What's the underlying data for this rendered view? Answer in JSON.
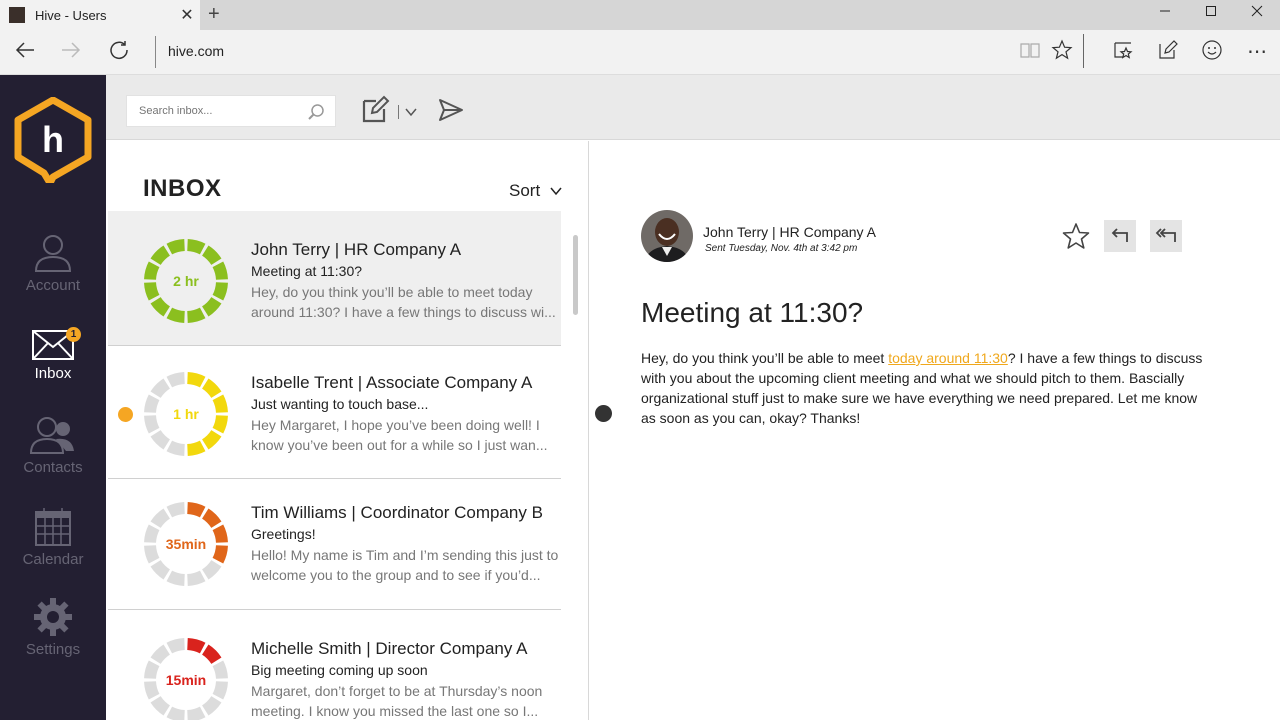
{
  "browser": {
    "tab_title": "Hive - Users",
    "tab_close": "✕",
    "new_tab": "+",
    "address": "hive.com",
    "window_controls": {
      "minimize": "—",
      "maximize": "☐",
      "close": "✕"
    },
    "nav_icons": {
      "back": "←",
      "forward": "→",
      "refresh": "↻",
      "more": "⋯"
    }
  },
  "sidebar": {
    "logo_letter": "h",
    "brand_color": "#f5a623",
    "items": [
      {
        "label": "Account",
        "icon": "person-icon",
        "active": false
      },
      {
        "label": "Inbox",
        "icon": "envelope-icon",
        "active": true,
        "badge": "1"
      },
      {
        "label": "Contacts",
        "icon": "contacts-icon",
        "active": false
      },
      {
        "label": "Calendar",
        "icon": "calendar-icon",
        "active": false
      },
      {
        "label": "Settings",
        "icon": "gear-icon",
        "active": false
      }
    ]
  },
  "toolbar": {
    "search_placeholder": "Search inbox..."
  },
  "inbox": {
    "title": "INBOX",
    "sort_label": "Sort",
    "messages": [
      {
        "from": "John Terry | HR Company A",
        "subject": "Meeting at 11:30?",
        "preview": "Hey, do you think you’ll be able to meet today around 11:30? I have a few things to discuss wi...",
        "timer": "2 hr",
        "color": "#8bbf1f",
        "filled_fraction": 1.0,
        "unread": false,
        "selected": true
      },
      {
        "from": "Isabelle Trent | Associate Company A",
        "subject": "Just wanting to touch base...",
        "preview": "Hey Margaret, I hope you’ve been doing well! I know you’ve been out for a while so I just wan...",
        "timer": "1 hr",
        "color": "#f2d80d",
        "filled_fraction": 0.5,
        "unread": true,
        "selected": false
      },
      {
        "from": "Tim Williams | Coordinator Company B",
        "subject": "Greetings!",
        "preview": "Hello! My name is Tim and I’m sending this just to welcome you to the group and to see if you’d...",
        "timer": "35min",
        "color": "#e0661a",
        "filled_fraction": 0.33,
        "unread": false,
        "selected": false
      },
      {
        "from": "Michelle Smith | Director Company A",
        "subject": "Big meeting coming up soon",
        "preview": "Margaret, don’t forget to be at Thursday’s noon meeting. I know you missed the last one so I...",
        "timer": "15min",
        "color": "#d9231d",
        "filled_fraction": 0.17,
        "unread": false,
        "selected": false
      }
    ]
  },
  "reader": {
    "sender": "John Terry | HR Company A",
    "sent": "Sent Tuesday, Nov. 4th at 3:42 pm",
    "subject": "Meeting at 11:30?",
    "body_before": "Hey, do you think you’ll be able to meet ",
    "body_link": "today around 11:30",
    "body_after": "? I have a few things to discuss with you about the upcoming client meeting and what we should pitch to them. Bascially organizational stuff just to make sure we have everything we need prepared. Let me know as soon as you can, okay? Thanks!"
  }
}
